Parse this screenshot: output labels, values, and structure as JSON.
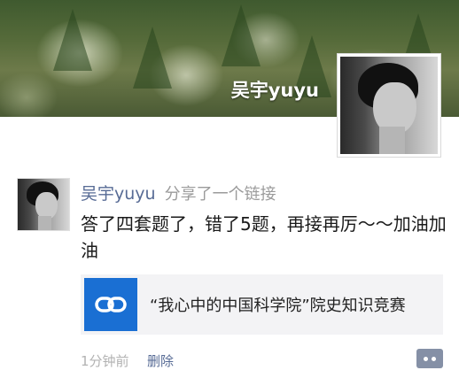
{
  "profile": {
    "name": "吴宇yuyu"
  },
  "post": {
    "author": "吴宇yuyu",
    "action": "分享了一个链接",
    "text": "答了四套题了，错了5题，再接再厉～～加油加油",
    "link": {
      "title": "“我心中的中国科学院”院史知识竞赛",
      "icon": "link-icon"
    },
    "time": "1分钟前",
    "delete_label": "删除",
    "comment_icon": "comment-icon"
  },
  "colors": {
    "author": "#576b95",
    "link_icon_bg": "#1a6fd3",
    "comment_btn_bg": "#8590a6"
  }
}
